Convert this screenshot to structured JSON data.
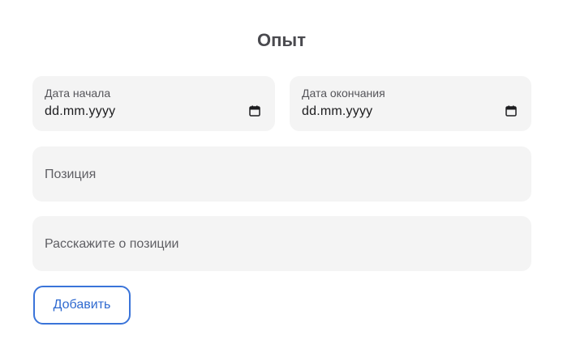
{
  "form": {
    "title": "Опыт",
    "start_date": {
      "label": "Дата начала",
      "value": "dd.mm.yyyy",
      "icon": "calendar-icon"
    },
    "end_date": {
      "label": "Дата окончания",
      "value": "dd.mm.yyyy",
      "icon": "calendar-icon"
    },
    "position": {
      "placeholder": "Позиция"
    },
    "about": {
      "placeholder": "Расскажите о позиции"
    },
    "add_button_label": "Добавить",
    "colors": {
      "field_background": "#f4f4f4",
      "accent": "#3a74d9",
      "title": "#4a4a4f"
    }
  }
}
